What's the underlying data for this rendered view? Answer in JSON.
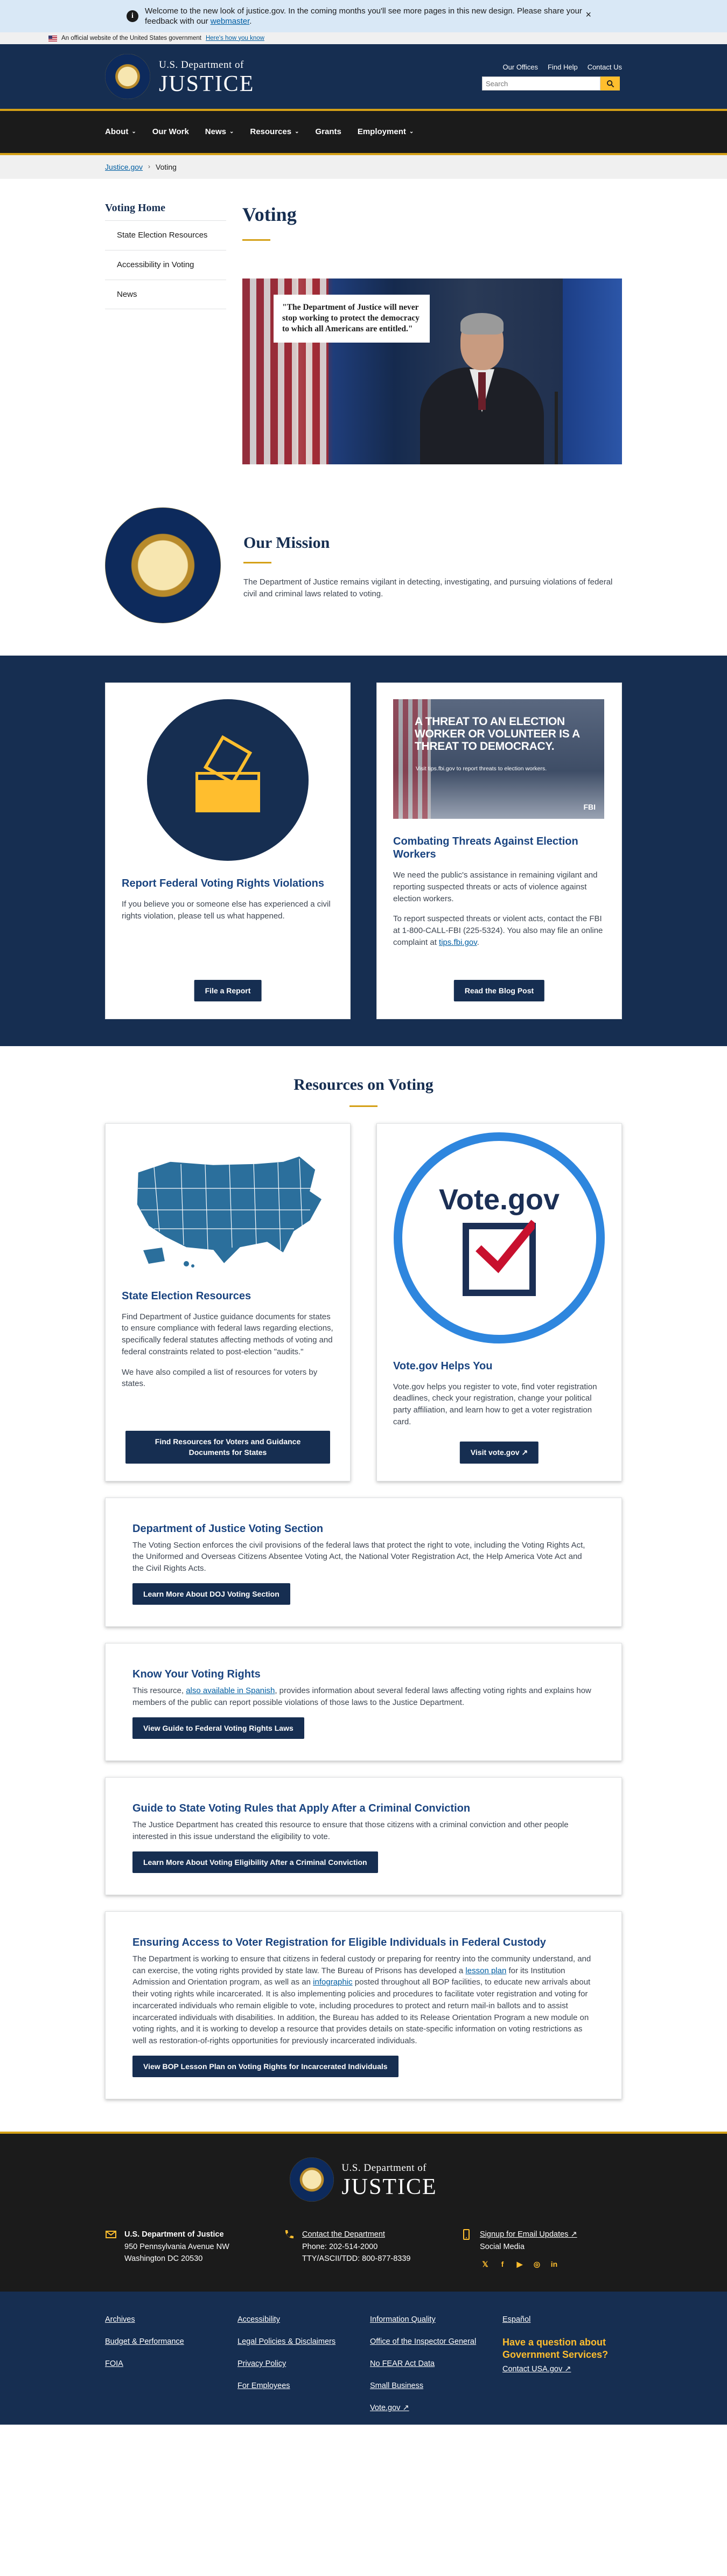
{
  "alert": {
    "message_prefix": "Welcome to the new look of justice.gov. In the coming months you'll see more pages in this new design. Please share your feedback with our ",
    "message_link": "webmaster",
    "message_suffix": ".",
    "close": "×"
  },
  "gov_banner": {
    "text": "An official website of the United States government",
    "link": "Here's how you know"
  },
  "header": {
    "brand_top": "U.S. Department of",
    "brand_main": "JUSTICE",
    "links": [
      "Our Offices",
      "Find Help",
      "Contact Us"
    ],
    "search_placeholder": "Search"
  },
  "nav": {
    "items": [
      {
        "label": "About",
        "dropdown": true
      },
      {
        "label": "Our Work",
        "dropdown": false
      },
      {
        "label": "News",
        "dropdown": true
      },
      {
        "label": "Resources",
        "dropdown": true
      },
      {
        "label": "Grants",
        "dropdown": false
      },
      {
        "label": "Employment",
        "dropdown": true
      }
    ]
  },
  "breadcrumb": {
    "home": "Justice.gov",
    "current": "Voting"
  },
  "sidenav": {
    "heading": "Voting Home",
    "items": [
      "State Election Resources",
      "Accessibility in Voting",
      "News"
    ]
  },
  "page": {
    "title": "Voting",
    "hero_quote": "\"The Department of Justice will never stop working to protect the democracy to which all Americans are entitled.\""
  },
  "mission": {
    "title": "Our Mission",
    "text": "The Department of Justice remains vigilant in detecting, investigating, and pursuing violations of federal civil and criminal laws related to voting."
  },
  "cards": {
    "report": {
      "title": "Report Federal Voting Rights Violations",
      "text": "If you believe you or someone else has experienced a civil rights violation, please tell us what happened.",
      "button": "File a Report"
    },
    "threats": {
      "image_headline": "A THREAT TO AN ELECTION WORKER OR VOLUNTEER IS A THREAT TO DEMOCRACY.",
      "image_sub": "Visit tips.fbi.gov to report threats to election workers.",
      "image_logo": "FBI",
      "title": "Combating Threats Against Election Workers",
      "text1": "We need the public's assistance in remaining vigilant and reporting suspected threats or acts of violence against election workers.",
      "text2_prefix": "To report suspected threats or violent acts, contact the FBI at 1-800-CALL-FBI (225-5324). You also may file an online complaint at ",
      "text2_link": "tips.fbi.gov",
      "text2_suffix": ".",
      "button": "Read the Blog Post"
    }
  },
  "resources": {
    "title": "Resources on Voting",
    "state": {
      "title": "State Election Resources",
      "text1": "Find Department of Justice guidance documents for states to ensure compliance with federal laws regarding elections, specifically federal statutes affecting methods of voting and federal constraints related to post-election \"audits.\"",
      "text2": "We have also compiled a list of resources for voters by states.",
      "button": "Find Resources for Voters and Guidance Documents for States"
    },
    "votegov": {
      "logo": "Vote.gov",
      "title": "Vote.gov Helps You",
      "text": "Vote.gov helps you register to vote, find voter registration deadlines, check your registration, change your political party affiliation, and learn how to get a voter registration card.",
      "button": "Visit vote.gov ↗"
    },
    "voting_section": {
      "title": "Department of Justice Voting Section",
      "text": "The Voting Section enforces the civil provisions of the federal laws that protect the right to vote, including the Voting Rights Act, the Uniformed and Overseas Citizens Absentee Voting Act, the National Voter Registration Act, the Help America Vote Act and the Civil Rights Acts.",
      "button": "Learn More About DOJ Voting Section"
    },
    "rights": {
      "title": "Know Your Voting Rights",
      "text_prefix": "This resource, ",
      "text_link": "also available in Spanish",
      "text_suffix": ", provides information about several federal laws affecting voting rights and explains how members of the public can report possible violations of those laws to the Justice Department.",
      "button": "View Guide to Federal Voting Rights Laws"
    },
    "conviction": {
      "title": "Guide to State Voting Rules that Apply After a Criminal Conviction",
      "text": "The Justice Department has created this resource to ensure that those citizens with a criminal conviction and other people interested in this issue understand the eligibility to vote.",
      "button": "Learn More About Voting Eligibility After a Criminal Conviction"
    },
    "custody": {
      "title": "Ensuring Access to Voter Registration for Eligible Individuals in Federal Custody",
      "text_a": "The Department is working to ensure that citizens in federal custody or preparing for reentry into the community understand, and can exercise, the voting rights provided by state law. The Bureau of Prisons has developed a ",
      "link_a": "lesson plan",
      "text_b": " for its Institution Admission and Orientation program, as well as an ",
      "link_b": "infographic",
      "text_c": " posted throughout all BOP facilities, to educate new arrivals about their voting rights while incarcerated. It is also implementing policies and procedures to facilitate voter registration and voting for incarcerated individuals who remain eligible to vote, including procedures to protect and return mail-in ballots and to assist incarcerated individuals with disabilities. In addition, the Bureau has added to its Release Orientation Program a new module on voting rights, and it is working to develop a resource that provides details on state-specific information on voting restrictions as well as restoration-of-rights opportunities for previously incarcerated individuals.",
      "button": "View BOP Lesson Plan on Voting Rights for Incarcerated Individuals"
    }
  },
  "footer": {
    "brand_top": "U.S. Department of",
    "brand_main": "JUSTICE",
    "address_title": "U.S. Department of Justice",
    "address_line1": "950 Pennsylvania Avenue NW",
    "address_line2": "Washington DC 20530",
    "contact_link": "Contact the Department",
    "phone": "Phone: 202-514-2000",
    "tty": "TTY/ASCII/TDD: 800-877-8339",
    "signup": "Signup for Email Updates ↗",
    "social_media": "Social Media",
    "links_col1": [
      "Archives",
      "Budget & Performance",
      "FOIA"
    ],
    "links_col2": [
      "Accessibility",
      "Legal Policies & Disclaimers",
      "Privacy Policy",
      "For Employees"
    ],
    "links_col3": [
      "Information Quality",
      "Office of the Inspector General",
      "No FEAR Act Data",
      "Small Business",
      "Vote.gov ↗"
    ],
    "espanol": "Español",
    "question": "Have a question about Government Services?",
    "usa_link": "Contact USA.gov ↗"
  },
  "colors": {
    "navy": "#162e51",
    "gold": "#d4a017",
    "yellow": "#ffbe2e",
    "link": "#005ea2"
  }
}
